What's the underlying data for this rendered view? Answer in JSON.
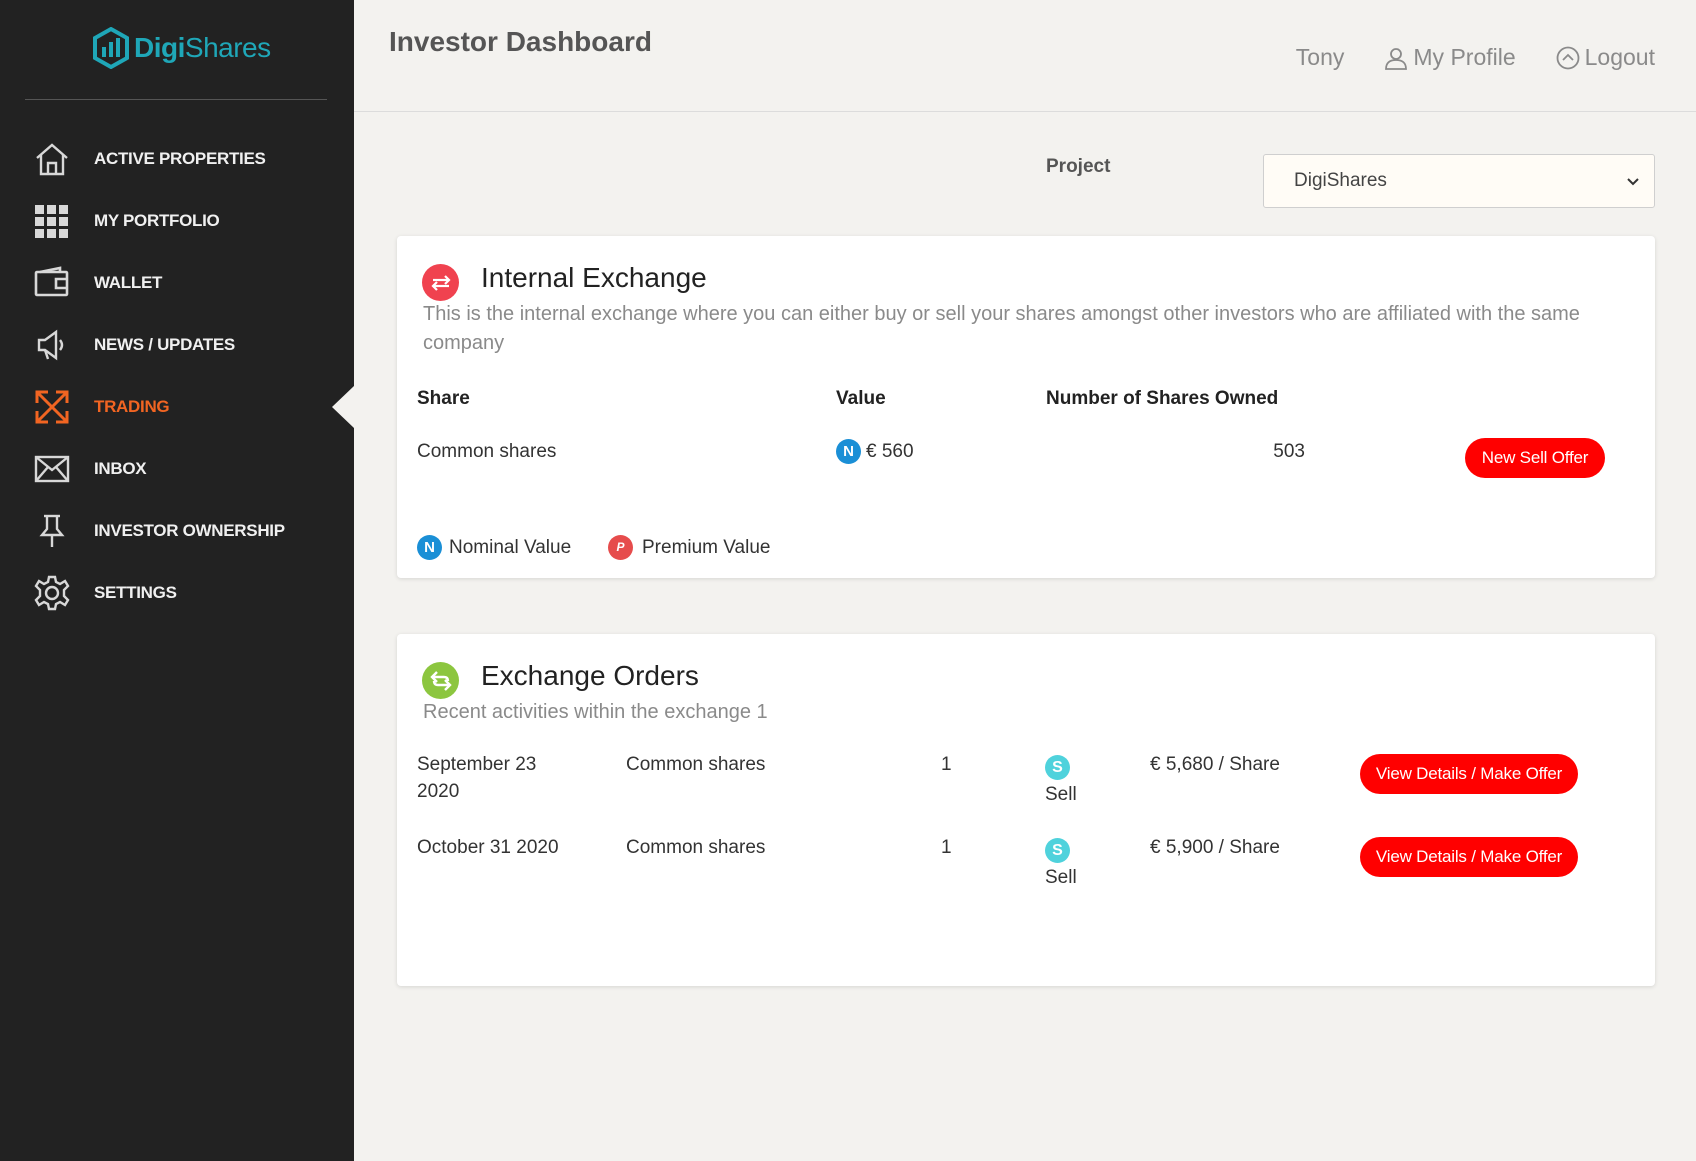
{
  "brand": {
    "name_part1": "Digi",
    "name_part2": "Shares",
    "color": "#1fa7b8"
  },
  "sidebar": {
    "items": [
      {
        "label": "ACTIVE PROPERTIES",
        "icon": "home-icon",
        "active": false
      },
      {
        "label": "MY PORTFOLIO",
        "icon": "grid-icon",
        "active": false
      },
      {
        "label": "WALLET",
        "icon": "wallet-icon",
        "active": false
      },
      {
        "label": "NEWS / UPDATES",
        "icon": "megaphone-icon",
        "active": false
      },
      {
        "label": "TRADING",
        "icon": "shuffle-icon",
        "active": true
      },
      {
        "label": "INBOX",
        "icon": "envelope-icon",
        "active": false
      },
      {
        "label": "INVESTOR OWNERSHIP",
        "icon": "pin-icon",
        "active": false
      },
      {
        "label": "SETTINGS",
        "icon": "gear-icon",
        "active": false
      }
    ],
    "accent": "#f26522"
  },
  "header": {
    "title": "Investor Dashboard",
    "user": "Tony",
    "profile_label": "My Profile",
    "logout_label": "Logout"
  },
  "project": {
    "label": "Project",
    "selected": "DigiShares"
  },
  "internal_exchange": {
    "title": "Internal Exchange",
    "description": "This is the internal exchange where you can either buy or sell your shares amongst other investors who are affiliated with the same company",
    "columns": [
      "Share",
      "Value",
      "Number of Shares Owned"
    ],
    "rows": [
      {
        "share": "Common shares",
        "value_badge": "N",
        "value": "€ 560",
        "owned": "503",
        "action": "New Sell Offer"
      }
    ],
    "legend": [
      {
        "badge": "N",
        "label": "Nominal Value"
      },
      {
        "badge": "P",
        "label": "Premium Value"
      }
    ]
  },
  "exchange_orders": {
    "title": "Exchange Orders",
    "description": "Recent activities within the exchange 1",
    "rows": [
      {
        "date_line1": "September 23",
        "date_line2": "2020",
        "share": "Common shares",
        "qty": "1",
        "type_badge": "S",
        "type": "Sell",
        "price": "€ 5,680 / Share",
        "action": "View Details / Make Offer"
      },
      {
        "date_line1": "October 31 2020",
        "date_line2": "",
        "share": "Common shares",
        "qty": "1",
        "type_badge": "S",
        "type": "Sell",
        "price": "€ 5,900 / Share",
        "action": "View Details / Make Offer"
      }
    ]
  },
  "colors": {
    "sidebar_bg": "#222222",
    "button_red": "#ff0000",
    "nominal_blue": "#1a8fd6",
    "premium_red": "#e64c4c",
    "sell_cyan": "#4fd2dc",
    "exchange_icon_red": "#f0424f",
    "orders_icon_green": "#8cc63f"
  }
}
